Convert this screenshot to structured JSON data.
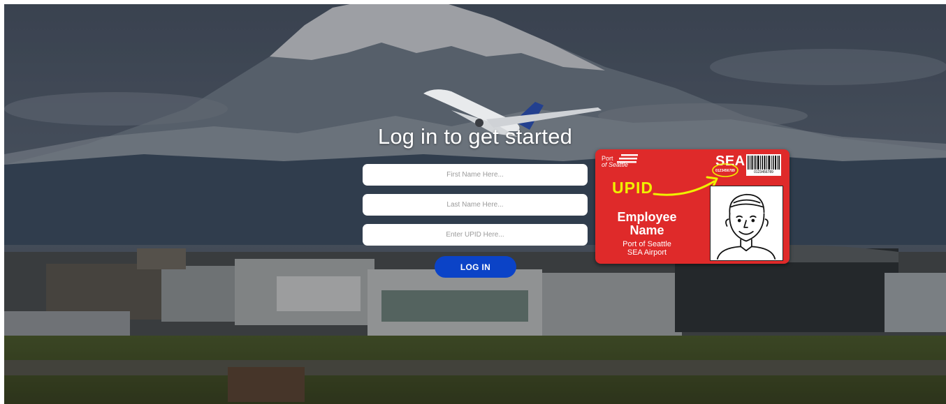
{
  "login": {
    "title": "Log in to get started",
    "first_name_placeholder": "First Name Here...",
    "last_name_placeholder": "Last Name Here...",
    "upid_placeholder": "Enter UPID Here...",
    "login_button_label": "LOG IN"
  },
  "badge": {
    "port_line1": "Port",
    "port_line2": "of Seattle",
    "airport_code": "SEA",
    "badge_number": "0123456789",
    "barcode_number": "0123456789",
    "upid_label": "UPID",
    "employee_name_line1": "Employee",
    "employee_name_line2": "Name",
    "org_line1": "Port of Seattle",
    "org_line2": "SEA Airport"
  },
  "colors": {
    "badge_red": "#df2a2a",
    "button_blue": "#0b43c7",
    "upid_yellow": "#f0f000"
  },
  "icons": {
    "arrow": "curved-arrow-icon",
    "portrait": "person-portrait-icon",
    "barcode": "barcode-icon",
    "airplane": "airplane-illustration"
  }
}
